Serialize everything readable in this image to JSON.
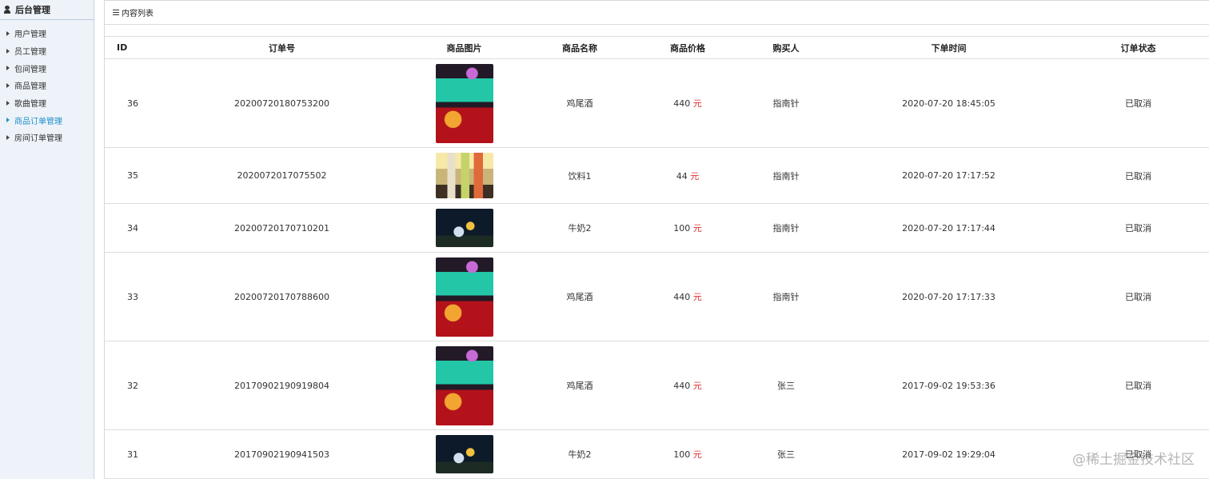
{
  "sidebar": {
    "title": "后台管理",
    "items": [
      {
        "label": "用户管理"
      },
      {
        "label": "员工管理"
      },
      {
        "label": "包间管理"
      },
      {
        "label": "商品管理"
      },
      {
        "label": "歌曲管理"
      },
      {
        "label": "商品订单管理"
      },
      {
        "label": "房间订单管理"
      }
    ]
  },
  "panel": {
    "title": "内容列表"
  },
  "table": {
    "headers": [
      "ID",
      "订单号",
      "商品图片",
      "商品名称",
      "商品价格",
      "购买人",
      "下单时间",
      "订单状态"
    ],
    "currency": "元",
    "rows": [
      {
        "id": "36",
        "order_no": "20200720180753200",
        "name": "鸡尾酒",
        "price": "440",
        "buyer": "指南针",
        "time": "2020-07-20 18:45:05",
        "status": "已取消"
      },
      {
        "id": "35",
        "order_no": "2020072017075502",
        "name": "饮料1",
        "price": "44",
        "buyer": "指南针",
        "time": "2020-07-20 17:17:52",
        "status": "已取消"
      },
      {
        "id": "34",
        "order_no": "20200720170710201",
        "name": "牛奶2",
        "price": "100",
        "buyer": "指南针",
        "time": "2020-07-20 17:17:44",
        "status": "已取消"
      },
      {
        "id": "33",
        "order_no": "20200720170788600",
        "name": "鸡尾酒",
        "price": "440",
        "buyer": "指南针",
        "time": "2020-07-20 17:17:33",
        "status": "已取消"
      },
      {
        "id": "32",
        "order_no": "20170902190919804",
        "name": "鸡尾酒",
        "price": "440",
        "buyer": "张三",
        "time": "2017-09-02 19:53:36",
        "status": "已取消"
      },
      {
        "id": "31",
        "order_no": "20170902190941503",
        "name": "牛奶2",
        "price": "100",
        "buyer": "张三",
        "time": "2017-09-02 19:29:04",
        "status": "已取消"
      }
    ]
  },
  "watermark": "@稀土掘金技术社区",
  "colors": {
    "active_menu": "#1f8fc9",
    "currency": "#e03030"
  }
}
